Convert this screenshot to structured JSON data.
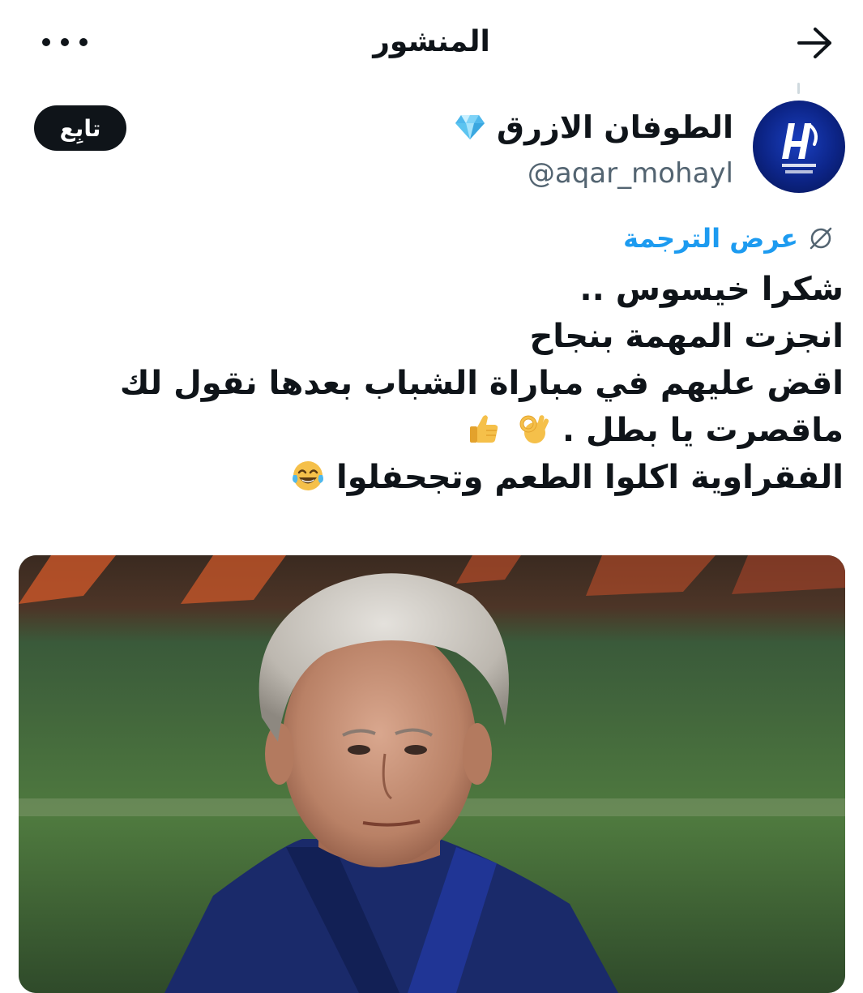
{
  "header": {
    "title": "المنشور",
    "more_icon": "more-horizontal-icon",
    "back_icon": "arrow-right-icon"
  },
  "author": {
    "display_name": "الطوفان الازرق",
    "badge_icon": "diamond-icon",
    "handle": "@aqar_mohayl",
    "avatar_icon": "alhilal-logo-avatar"
  },
  "follow": {
    "label": "تابِع"
  },
  "translate": {
    "label": "عرض الترجمة",
    "icon": "translate-globe-icon"
  },
  "post": {
    "lines": [
      "شكرا خيسوس ..",
      "انجزت المهمة بنجاح",
      "اقض عليهم في مباراة الشباب بعدها نقول لك",
      "ماقصرت يا بطل .",
      "الفقراوية اكلوا الطعم وتجحفلوا"
    ],
    "emoji_line4": [
      "ok-hand-emoji",
      "thumbs-up-emoji"
    ],
    "emoji_line5": [
      "tears-of-joy-emoji"
    ]
  },
  "media": {
    "type": "photo",
    "subject": "coach-portrait-photo"
  },
  "colors": {
    "text": "#0f1419",
    "secondary": "#536471",
    "link": "#1d9bf0",
    "follow_bg": "#0f1419"
  }
}
